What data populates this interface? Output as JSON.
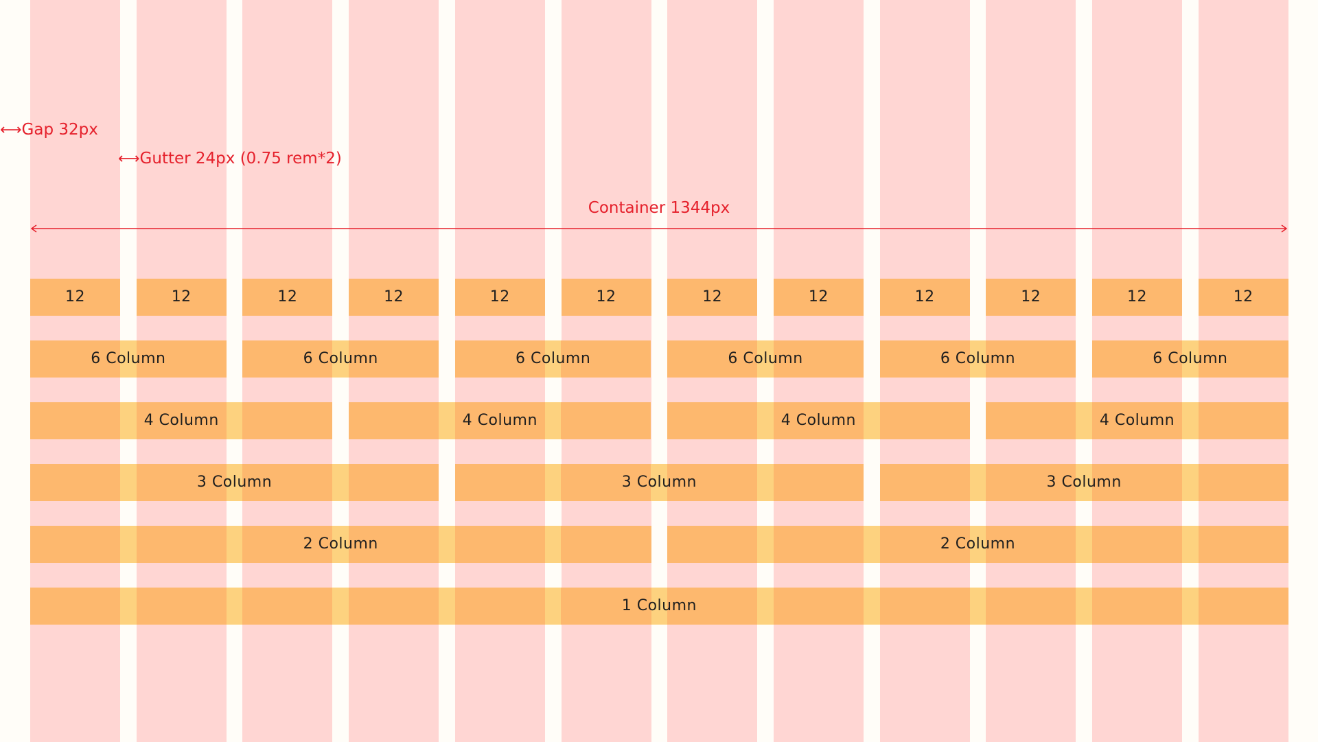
{
  "annotations": {
    "gap_label": "Gap 32px",
    "gutter_label": "Gutter 24px (0.75 rem*2)",
    "container_label": "Container 1344px"
  },
  "grid": {
    "columns": 12,
    "rows": [
      {
        "span": 1,
        "label": "12"
      },
      {
        "span": 2,
        "label": "6 Column"
      },
      {
        "span": 3,
        "label": "4 Column"
      },
      {
        "span": 4,
        "label": "3 Column"
      },
      {
        "span": 6,
        "label": "2 Column"
      },
      {
        "span": 12,
        "label": "1 Column"
      }
    ]
  },
  "colors": {
    "background": "#fffdf8",
    "column": "#ffd6d3",
    "bar": "#fdb86e",
    "bar_gutter": "#fdd27f",
    "annotation": "#e5212c",
    "text": "#1f1f1f"
  }
}
